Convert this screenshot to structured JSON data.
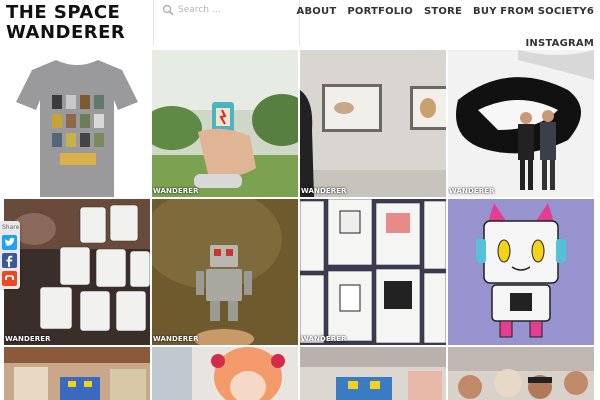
{
  "site": {
    "title_line1": "THE SPACE",
    "title_line2": "WANDERER"
  },
  "search": {
    "placeholder": "Search …",
    "value": ""
  },
  "nav": {
    "items": [
      {
        "label": "ABOUT"
      },
      {
        "label": "PORTFOLIO"
      },
      {
        "label": "STORE"
      },
      {
        "label": "BUY FROM SOCIETY6"
      }
    ],
    "second_row": {
      "label": "INSTAGRAM"
    }
  },
  "watermark": "WANDERER",
  "share": {
    "label": "Share",
    "buttons": [
      {
        "icon": "twitter-icon",
        "color": "#1da1f2"
      },
      {
        "icon": "facebook-icon",
        "color": "#3b5998"
      },
      {
        "icon": "stumbleupon-icon",
        "color": "#eb4924"
      }
    ]
  },
  "colors": {
    "accent": "#333333"
  }
}
